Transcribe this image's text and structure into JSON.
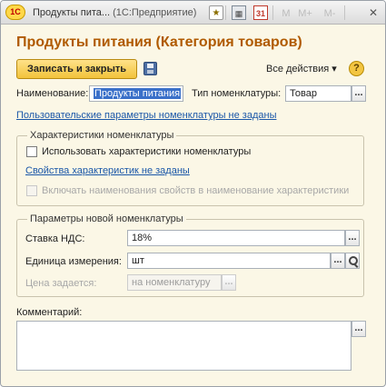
{
  "window": {
    "title": "Продукты пита...",
    "subtitle": "(1С:Предприятие)",
    "logo_text": "1С",
    "toolbar": {
      "memory_m": "M",
      "memory_plus": "M+",
      "memory_minus": "M-",
      "calendar_day": "31"
    }
  },
  "form": {
    "title": "Продукты питания (Категория товаров)",
    "save_close_label": "Записать и закрыть",
    "all_actions_label": "Все действия ▾",
    "help_label": "?",
    "name_label": "Наименование:",
    "name_value": "Продукты питания",
    "type_label": "Тип номенклатуры:",
    "type_value": "Товар",
    "custom_params_link": "Пользовательские параметры номенклатуры не заданы",
    "characteristics": {
      "title": "Характеристики номенклатуры",
      "use_label": "Использовать характеристики номенклатуры",
      "properties_link": "Свойства характеристик не заданы",
      "include_names_label": "Включать наименования свойств в наименование характеристики"
    },
    "new_item_params": {
      "title": "Параметры новой номенклатуры",
      "vat_label": "Ставка НДС:",
      "vat_value": "18%",
      "unit_label": "Единица измерения:",
      "unit_value": "шт",
      "price_label": "Цена задается:",
      "price_value": "на номенклатуру"
    },
    "comment_label": "Комментарий:",
    "comment_value": "",
    "ellipsis": "..."
  },
  "colors": {
    "title": "#b05a00",
    "link": "#1a57a8",
    "primary_button": "#f2c33b",
    "background": "#fbf7e6"
  }
}
